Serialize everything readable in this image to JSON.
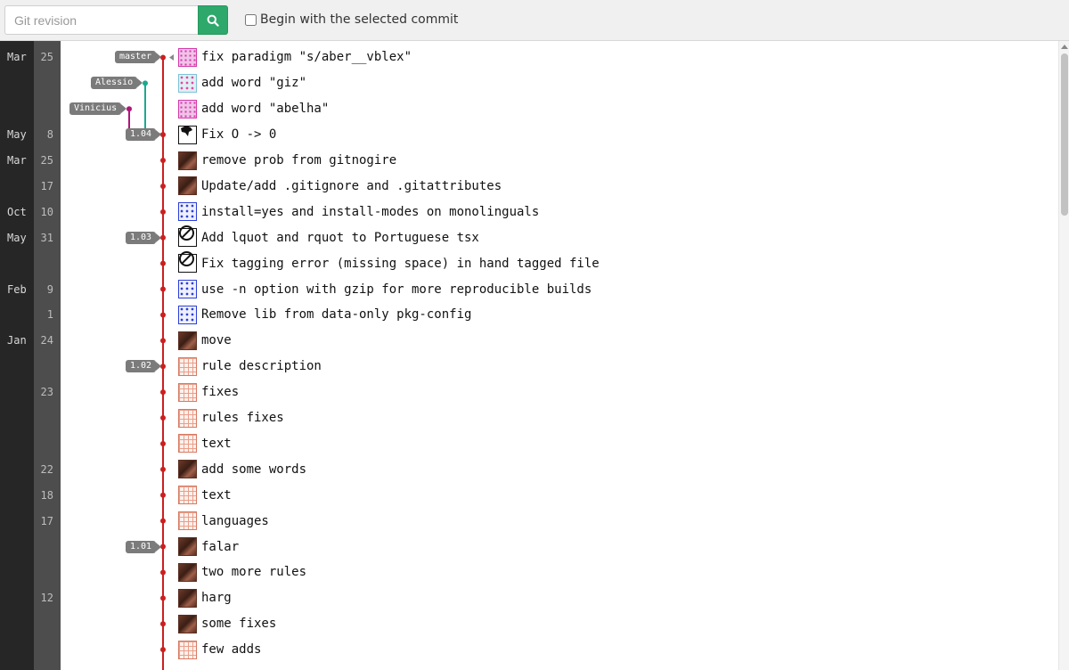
{
  "toolbar": {
    "search_placeholder": "Git revision",
    "search_icon": "search-icon",
    "begin_label": "Begin with the selected commit",
    "begin_checked": false
  },
  "colors": {
    "accent": "#2ea86b",
    "main_branch": "#cc1f1f",
    "alessio_branch": "#1aa98f",
    "vinicius_branch": "#b0147a",
    "tag_bg": "#7b7b7b"
  },
  "labels": [
    {
      "text": "master",
      "row": 0
    },
    {
      "text": "Alessio",
      "row": 1
    },
    {
      "text": "Vinicius",
      "row": 2
    },
    {
      "text": "1.04",
      "row": 3
    },
    {
      "text": "1.03",
      "row": 7
    },
    {
      "text": "1.02",
      "row": 12
    },
    {
      "text": "1.01",
      "row": 19
    }
  ],
  "commits": [
    {
      "month": "Mar",
      "day": "25",
      "message": "fix paradigm \"s/aber__vblex\"",
      "avatar": "pink-identicon"
    },
    {
      "month": "",
      "day": "",
      "message": "add word \"giz\"",
      "avatar": "teal-identicon"
    },
    {
      "month": "",
      "day": "",
      "message": "add word \"abelha\"",
      "avatar": "pink-identicon"
    },
    {
      "month": "May",
      "day": "8",
      "message": "Fix O -> 0",
      "avatar": "map-avatar"
    },
    {
      "month": "Mar",
      "day": "25",
      "message": "remove prob from gitnogire",
      "avatar": "photo-avatar"
    },
    {
      "month": "",
      "day": "17",
      "message": "Update/add .gitignore and .gitattributes",
      "avatar": "photo-avatar"
    },
    {
      "month": "Oct",
      "day": "10",
      "message": "install=yes and install-modes on monolinguals",
      "avatar": "blue-identicon"
    },
    {
      "month": "May",
      "day": "31",
      "message": "Add lquot and rquot to Portuguese tsx",
      "avatar": "no-entry-avatar"
    },
    {
      "month": "",
      "day": "",
      "message": "Fix tagging error (missing space) in hand tagged file",
      "avatar": "no-entry-avatar"
    },
    {
      "month": "Feb",
      "day": "9",
      "message": "use -n option with gzip for more reproducible builds",
      "avatar": "blue-identicon"
    },
    {
      "month": "",
      "day": "1",
      "message": "Remove lib from data-only pkg-config",
      "avatar": "blue-identicon"
    },
    {
      "month": "Jan",
      "day": "24",
      "message": "move",
      "avatar": "photo-avatar"
    },
    {
      "month": "",
      "day": "",
      "message": "rule description",
      "avatar": "grid-identicon"
    },
    {
      "month": "",
      "day": "23",
      "message": "fixes",
      "avatar": "grid-identicon"
    },
    {
      "month": "",
      "day": "",
      "message": "rules fixes",
      "avatar": "grid-identicon"
    },
    {
      "month": "",
      "day": "",
      "message": "text",
      "avatar": "grid-identicon"
    },
    {
      "month": "",
      "day": "22",
      "message": "add some words",
      "avatar": "photo-avatar"
    },
    {
      "month": "",
      "day": "18",
      "message": "text",
      "avatar": "grid-identicon"
    },
    {
      "month": "",
      "day": "17",
      "message": "languages",
      "avatar": "grid-identicon"
    },
    {
      "month": "",
      "day": "",
      "message": "falar",
      "avatar": "photo-avatar"
    },
    {
      "month": "",
      "day": "",
      "message": "two more rules",
      "avatar": "photo-avatar"
    },
    {
      "month": "",
      "day": "12",
      "message": "harg",
      "avatar": "photo-avatar"
    },
    {
      "month": "",
      "day": "",
      "message": "some fixes",
      "avatar": "photo-avatar"
    },
    {
      "month": "",
      "day": "",
      "message": "few adds",
      "avatar": "grid-identicon"
    }
  ]
}
